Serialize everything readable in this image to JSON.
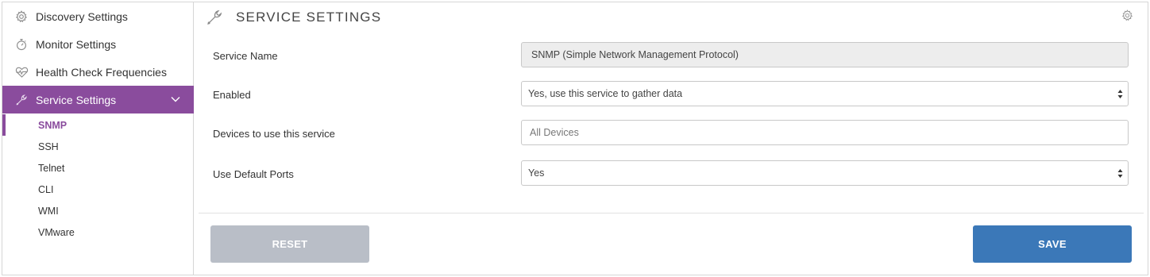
{
  "sidebar": {
    "items": [
      {
        "label": "Discovery Settings",
        "icon": "gear-icon"
      },
      {
        "label": "Monitor Settings",
        "icon": "stopwatch-icon"
      },
      {
        "label": "Health Check Frequencies",
        "icon": "heartbeat-icon"
      },
      {
        "label": "Service Settings",
        "icon": "wrench-icon",
        "active": true,
        "expanded": true
      }
    ],
    "sub_items": [
      {
        "label": "SNMP",
        "active": true
      },
      {
        "label": "SSH"
      },
      {
        "label": "Telnet"
      },
      {
        "label": "CLI"
      },
      {
        "label": "WMI"
      },
      {
        "label": "VMware"
      }
    ]
  },
  "main": {
    "title": "SERVICE SETTINGS",
    "title_icon": "wrench-icon",
    "fields": {
      "service_name": {
        "label": "Service Name",
        "value": "SNMP (Simple Network Management Protocol)"
      },
      "enabled": {
        "label": "Enabled",
        "value": "Yes, use this service to gather data"
      },
      "devices": {
        "label": "Devices to use this service",
        "placeholder": "All Devices"
      },
      "default_ports": {
        "label": "Use Default Ports",
        "value": "Yes"
      }
    },
    "buttons": {
      "reset": "RESET",
      "save": "SAVE"
    }
  },
  "colors": {
    "accent": "#8a4c9d",
    "save": "#3b78b8",
    "reset": "#b9bec7"
  }
}
